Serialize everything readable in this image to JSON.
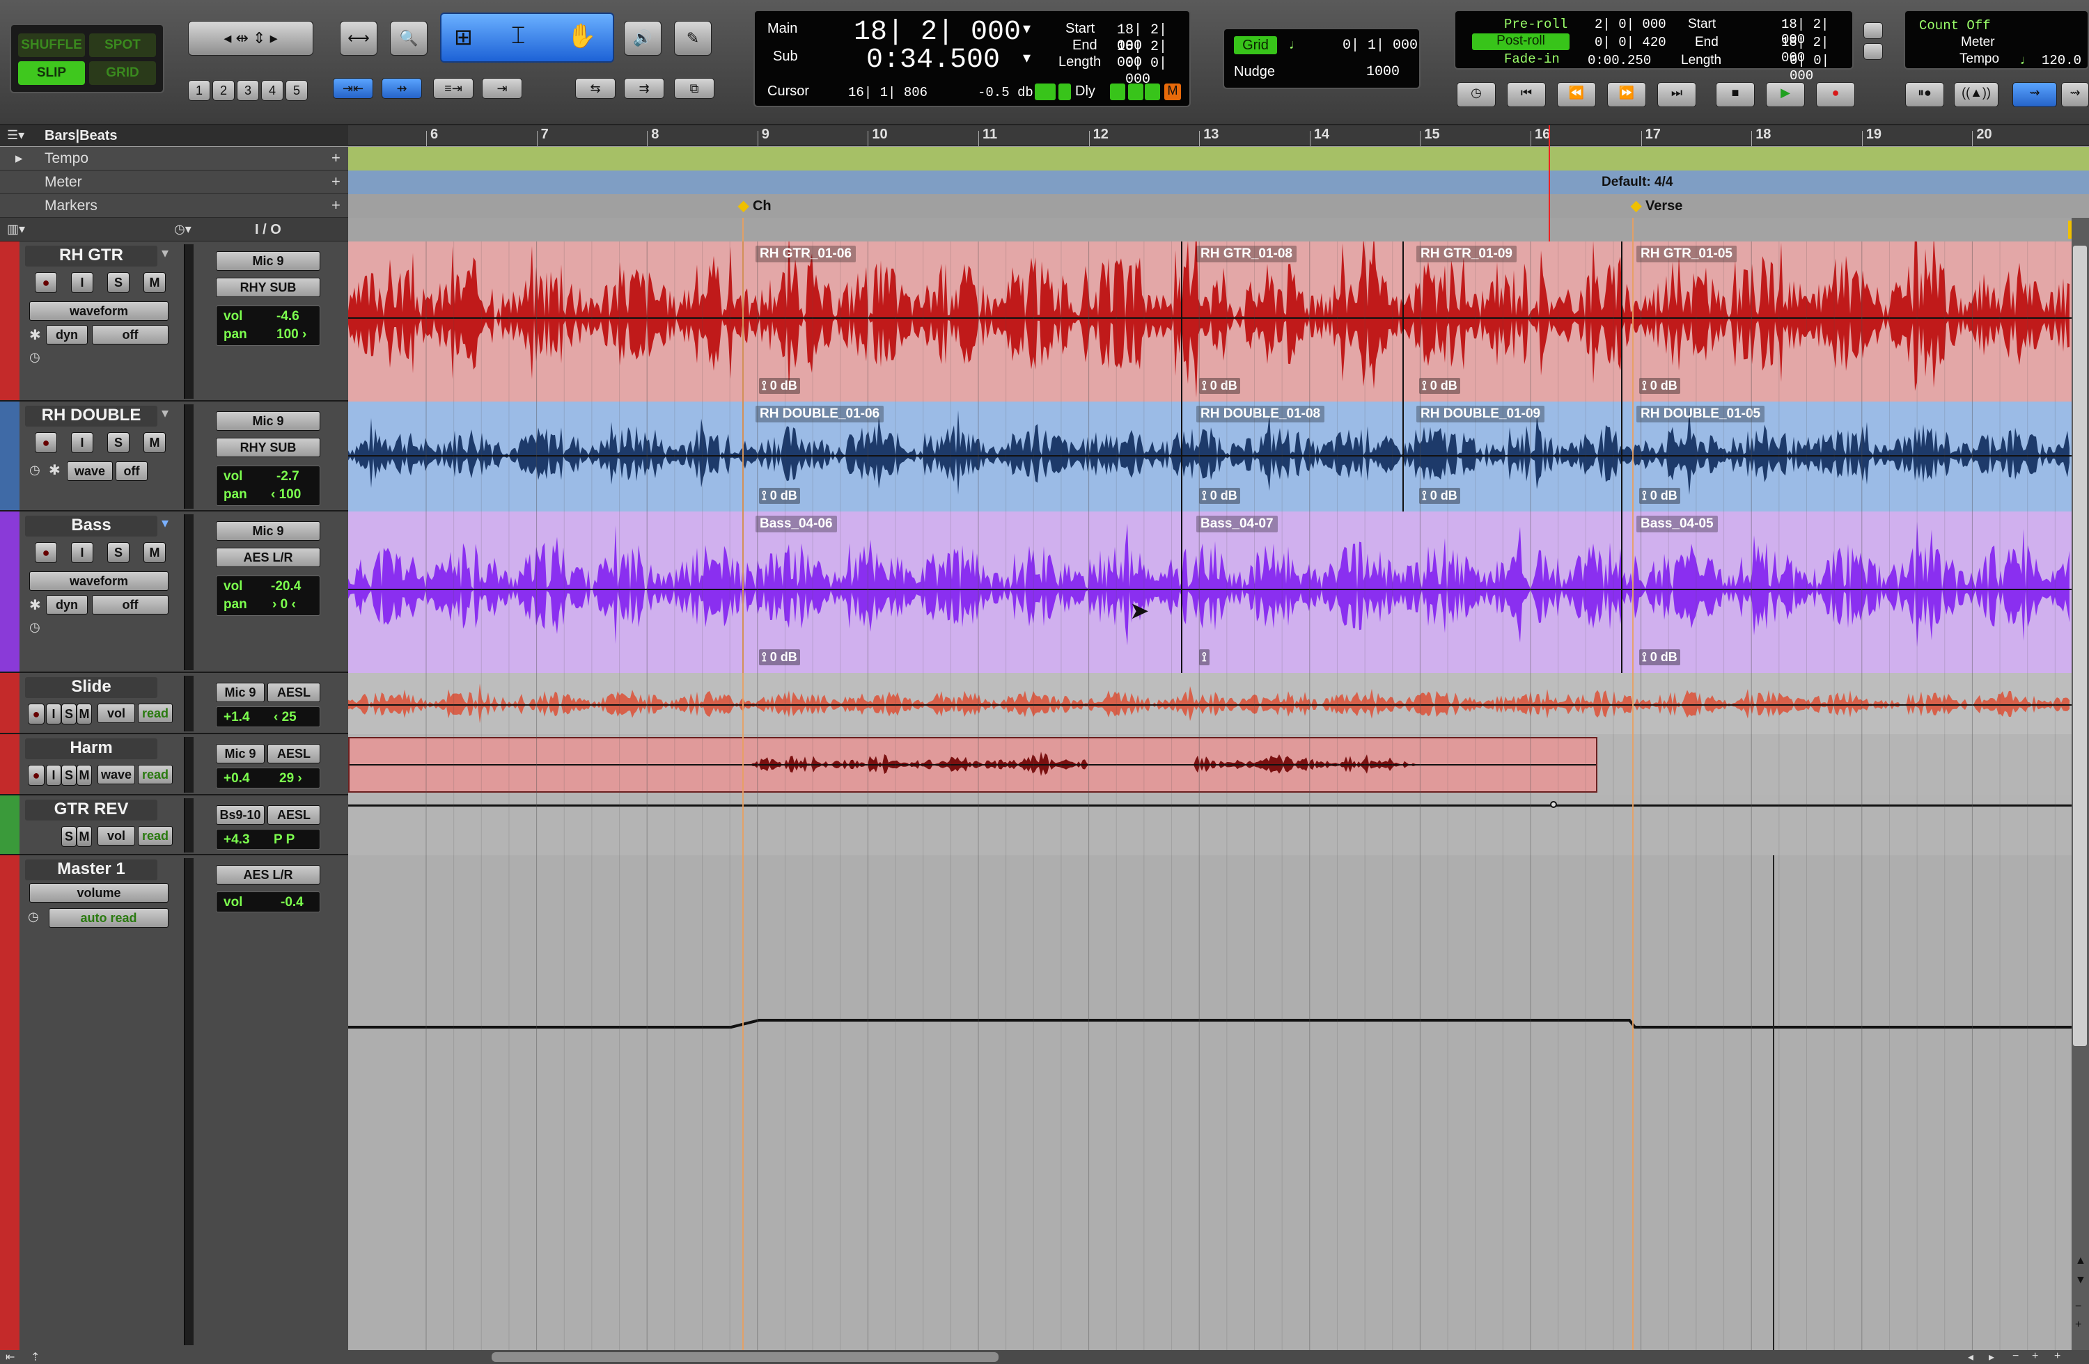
{
  "modes": {
    "shuffle": "SHUFFLE",
    "spot": "SPOT",
    "slip": "SLIP",
    "grid": "GRID"
  },
  "tool_numbers": [
    "1",
    "2",
    "3",
    "4",
    "5"
  ],
  "counter": {
    "main_label": "Main",
    "main_value": "18| 2| 000",
    "sub_label": "Sub",
    "sub_value": "0:34.500",
    "cursor_label": "Cursor",
    "cursor_value": "16| 1| 806",
    "cursor_db": "-0.5 db",
    "dly": "Dly",
    "start_label": "Start",
    "start_value": "18| 2| 000",
    "end_label": "End",
    "end_value": "18| 2| 000",
    "length_label": "Length",
    "length_value": "0| 0| 000"
  },
  "grid": {
    "label": "Grid",
    "value": "0| 1| 000",
    "nudge_label": "Nudge",
    "nudge_value": "1000"
  },
  "transport": {
    "preroll_label": "Pre-roll",
    "preroll_value": "2| 0| 000",
    "postroll_label": "Post-roll",
    "postroll_value": "0| 0| 420",
    "fadein_label": "Fade-in",
    "fadein_value": "0:00.250",
    "start_label": "Start",
    "start_value": "18| 2| 000",
    "end_label": "End",
    "end_value": "18| 2| 000",
    "length_label": "Length",
    "length_value": "0| 0| 000"
  },
  "count": {
    "countoff": "Count Off",
    "meter": "Meter",
    "tempo": "Tempo",
    "tempo_value": "120.0"
  },
  "ruler": {
    "bars_label": "Bars|Beats",
    "bars": [
      "6",
      "7",
      "8",
      "9",
      "10",
      "11",
      "12",
      "13",
      "14",
      "15",
      "16",
      "17",
      "18",
      "19",
      "20"
    ],
    "tempo_label": "Tempo",
    "meter_label": "Meter",
    "markers_label": "Markers",
    "meter_default": "Default: 4/4",
    "marker_ch": "Ch",
    "marker_verse": "Verse",
    "io_label": "I / O"
  },
  "tracks": [
    {
      "name": "RH GTR",
      "view": "waveform",
      "dyn": "dyn",
      "off": "off",
      "input": "Mic 9",
      "output": "RHY SUB",
      "vol": "-4.6",
      "pan": "100 ›",
      "vol_label": "vol",
      "pan_label": "pan",
      "color": "#c42a2a",
      "clips": [
        {
          "name": "RH GTR_01-06",
          "gain": "0 dB"
        },
        {
          "name": "RH GTR_01-08",
          "gain": "0 dB"
        },
        {
          "name": "RH GTR_01-09",
          "gain": "0 dB"
        },
        {
          "name": "RH GTR_01-05",
          "gain": "0 dB"
        }
      ]
    },
    {
      "name": "RH DOUBLE",
      "view": "wave",
      "off": "off",
      "input": "Mic 9",
      "output": "RHY SUB",
      "vol": "-2.7",
      "pan": "‹ 100",
      "vol_label": "vol",
      "pan_label": "pan",
      "color": "#3f6aa6",
      "clips": [
        {
          "name": "RH DOUBLE_01-06",
          "gain": "0 dB"
        },
        {
          "name": "RH DOUBLE_01-08",
          "gain": "0 dB"
        },
        {
          "name": "RH DOUBLE_01-09",
          "gain": "0 dB"
        },
        {
          "name": "RH DOUBLE_01-05",
          "gain": "0 dB"
        }
      ]
    },
    {
      "name": "Bass",
      "view": "waveform",
      "dyn": "dyn",
      "off": "off",
      "input": "Mic 9",
      "output": "AES L/R",
      "vol": "-20.4",
      "pan": "› 0 ‹",
      "vol_label": "vol",
      "pan_label": "pan",
      "color": "#8a3ad8",
      "clips": [
        {
          "name": "Bass_04-06",
          "gain": "0 dB"
        },
        {
          "name": "Bass_04-07",
          "gain": ""
        },
        {
          "name": "Bass_04-05",
          "gain": "0 dB"
        }
      ]
    },
    {
      "name": "Slide",
      "view": "vol",
      "auto": "read",
      "input": "Mic 9",
      "output": "AESL",
      "vol": "+1.4",
      "pan": "‹ 25",
      "color": "#c42a2a"
    },
    {
      "name": "Harm",
      "view": "wave",
      "auto": "read",
      "input": "Mic 9",
      "output": "AESL",
      "vol": "+0.4",
      "pan": "29 ›",
      "color": "#c42a2a"
    },
    {
      "name": "GTR REV",
      "view": "vol",
      "auto": "read",
      "input": "Bs9-10",
      "output": "AESL",
      "vol": "+4.3",
      "pan": "P   P",
      "color": "#3a9a3a"
    },
    {
      "name": "Master 1",
      "view": "volume",
      "auto": "auto read",
      "output": "AES L/R",
      "vol": "-0.4",
      "vol_label": "vol",
      "color": "#c42a2a"
    }
  ],
  "solo_label": "S",
  "mute_label": "M",
  "input_label": "I"
}
